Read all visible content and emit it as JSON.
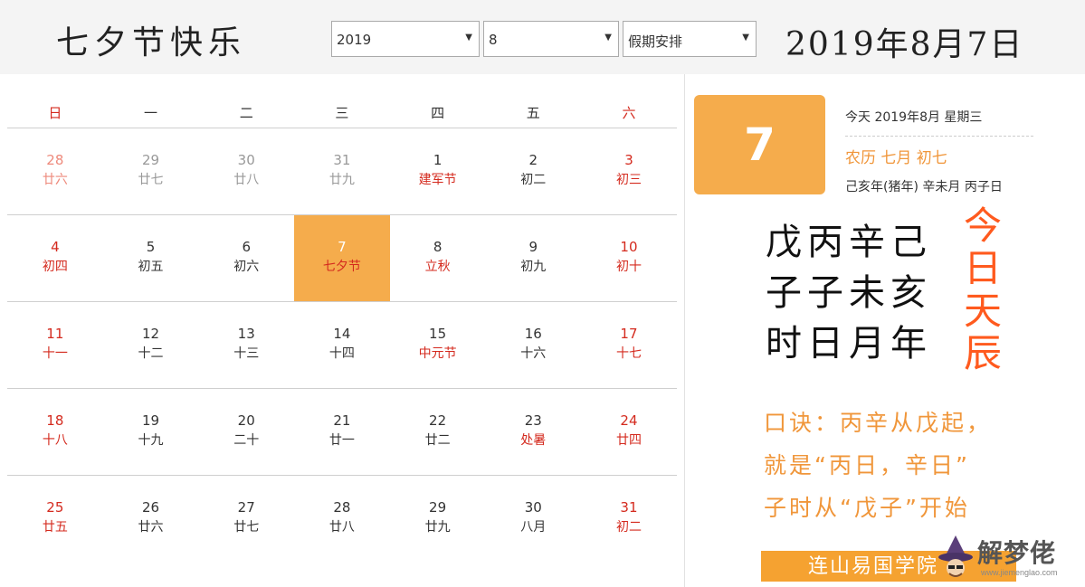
{
  "header": {
    "title": "七夕节快乐",
    "year_select": "2019",
    "month_select": "8",
    "holiday_select": "假期安排",
    "current_date": "2019年8月7日"
  },
  "calendar": {
    "weekdays": [
      "日",
      "一",
      "二",
      "三",
      "四",
      "五",
      "六"
    ],
    "weeks": [
      [
        {
          "day": "28",
          "lunar": "廿六"
        },
        {
          "day": "29",
          "lunar": "廿七"
        },
        {
          "day": "30",
          "lunar": "廿八"
        },
        {
          "day": "31",
          "lunar": "廿九"
        },
        {
          "day": "1",
          "lunar": "建军节"
        },
        {
          "day": "2",
          "lunar": "初二"
        },
        {
          "day": "3",
          "lunar": "初三"
        }
      ],
      [
        {
          "day": "4",
          "lunar": "初四"
        },
        {
          "day": "5",
          "lunar": "初五"
        },
        {
          "day": "6",
          "lunar": "初六"
        },
        {
          "day": "7",
          "lunar": "七夕节"
        },
        {
          "day": "8",
          "lunar": "立秋"
        },
        {
          "day": "9",
          "lunar": "初九"
        },
        {
          "day": "10",
          "lunar": "初十"
        }
      ],
      [
        {
          "day": "11",
          "lunar": "十一"
        },
        {
          "day": "12",
          "lunar": "十二"
        },
        {
          "day": "13",
          "lunar": "十三"
        },
        {
          "day": "14",
          "lunar": "十四"
        },
        {
          "day": "15",
          "lunar": "中元节"
        },
        {
          "day": "16",
          "lunar": "十六"
        },
        {
          "day": "17",
          "lunar": "十七"
        }
      ],
      [
        {
          "day": "18",
          "lunar": "十八"
        },
        {
          "day": "19",
          "lunar": "十九"
        },
        {
          "day": "20",
          "lunar": "二十"
        },
        {
          "day": "21",
          "lunar": "廿一"
        },
        {
          "day": "22",
          "lunar": "廿二"
        },
        {
          "day": "23",
          "lunar": "处暑"
        },
        {
          "day": "24",
          "lunar": "廿四"
        }
      ],
      [
        {
          "day": "25",
          "lunar": "廿五"
        },
        {
          "day": "26",
          "lunar": "廿六"
        },
        {
          "day": "27",
          "lunar": "廿七"
        },
        {
          "day": "28",
          "lunar": "廿八"
        },
        {
          "day": "29",
          "lunar": "廿九"
        },
        {
          "day": "30",
          "lunar": "八月"
        },
        {
          "day": "31",
          "lunar": "初二"
        }
      ]
    ]
  },
  "detail": {
    "day_number": "7",
    "today_line": "今天 2019年8月 星期三",
    "lunar_line": "农历 七月 初七",
    "ganzhi_line": "己亥年(猪年) 辛未月 丙子日"
  },
  "chen": {
    "lines": [
      "戊丙辛己",
      "子子未亥",
      "时日月年"
    ],
    "vertical": [
      "今",
      "日",
      "天",
      "辰"
    ]
  },
  "mnemonic": {
    "lines": [
      "口诀：丙辛从戊起，",
      "就是“丙日，辛日”",
      "子时从“戊子”开始"
    ]
  },
  "footer": {
    "academy_label": "连山易国学院"
  },
  "watermark": {
    "brand": "解梦佬",
    "url": "www.jiemenglao.com"
  },
  "colors": {
    "accent_orange": "#f5ac4c",
    "holiday_red": "#d42a1e",
    "lunar_orange": "#f0963a",
    "chen_red": "#ff5a1e"
  }
}
